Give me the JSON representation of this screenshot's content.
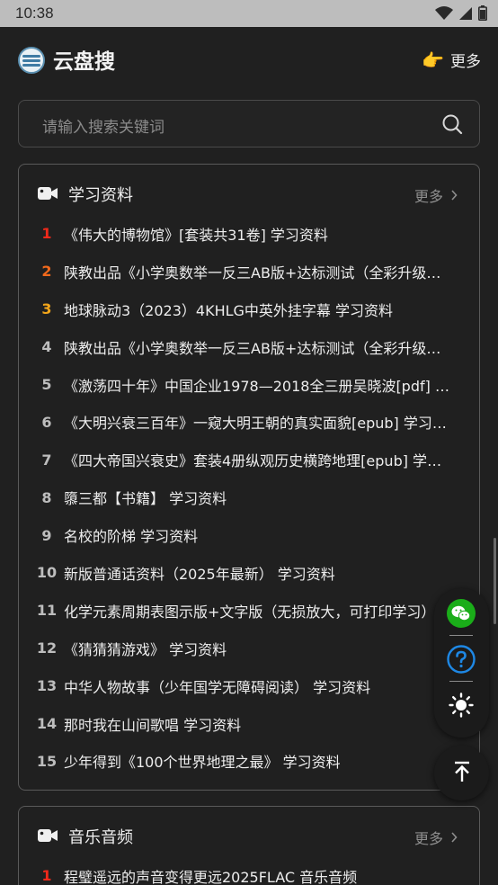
{
  "status_bar": {
    "time": "10:38"
  },
  "app": {
    "title": "云盘搜",
    "more_label": "更多"
  },
  "search": {
    "placeholder": "请输入搜索关键词"
  },
  "sections": [
    {
      "title": "学习资料",
      "more_label": "更多",
      "items": [
        {
          "rank": "1",
          "text": "《伟大的博物馆》[套装共31卷] 学习资料"
        },
        {
          "rank": "2",
          "text": "陕教出品《小学奥数举一反三AB版+达标测试（全彩升级版）》"
        },
        {
          "rank": "3",
          "text": "地球脉动3（2023）4KHLG中英外挂字幕 学习资料"
        },
        {
          "rank": "4",
          "text": "陕教出品《小学奥数举一反三AB版+达标测试（全彩升级版）》"
        },
        {
          "rank": "5",
          "text": "《激荡四十年》中国企业1978—2018全三册吴晓波[pdf] 学习资料"
        },
        {
          "rank": "6",
          "text": "《大明兴衰三百年》一窥大明王朝的真实面貌[epub] 学习资料"
        },
        {
          "rank": "7",
          "text": "《四大帝国兴衰史》套装4册纵观历史横跨地理[epub] 学习资料"
        },
        {
          "rank": "8",
          "text": "隳三都【书籍】 学习资料"
        },
        {
          "rank": "9",
          "text": "名校的阶梯 学习资料"
        },
        {
          "rank": "10",
          "text": "新版普通话资料（2025年最新） 学习资料"
        },
        {
          "rank": "11",
          "text": "化学元素周期表图示版+文字版（无损放大，可打印学习）"
        },
        {
          "rank": "12",
          "text": "《猜猜猜游戏》 学习资料"
        },
        {
          "rank": "13",
          "text": "中华人物故事（少年国学无障碍阅读） 学习资料"
        },
        {
          "rank": "14",
          "text": "那时我在山间歌唱 学习资料"
        },
        {
          "rank": "15",
          "text": "少年得到《100个世界地理之最》 学习资料"
        }
      ]
    },
    {
      "title": "音乐音频",
      "more_label": "更多",
      "items": [
        {
          "rank": "1",
          "text": "程璧遥远的声音变得更远2025FLAC 音乐音频"
        }
      ]
    }
  ],
  "colors": {
    "rank1": "#f0291a",
    "rank2": "#f2691c",
    "rank3": "#f2a51a",
    "wechat": "#1aad19",
    "help": "#1e88e5"
  },
  "icons": [
    "wifi-icon",
    "signal-icon",
    "battery-icon",
    "pointing-hand-icon",
    "search-icon",
    "video-camera-icon",
    "chevron-right-icon",
    "wechat-icon",
    "help-icon",
    "brightness-icon",
    "back-to-top-icon"
  ]
}
